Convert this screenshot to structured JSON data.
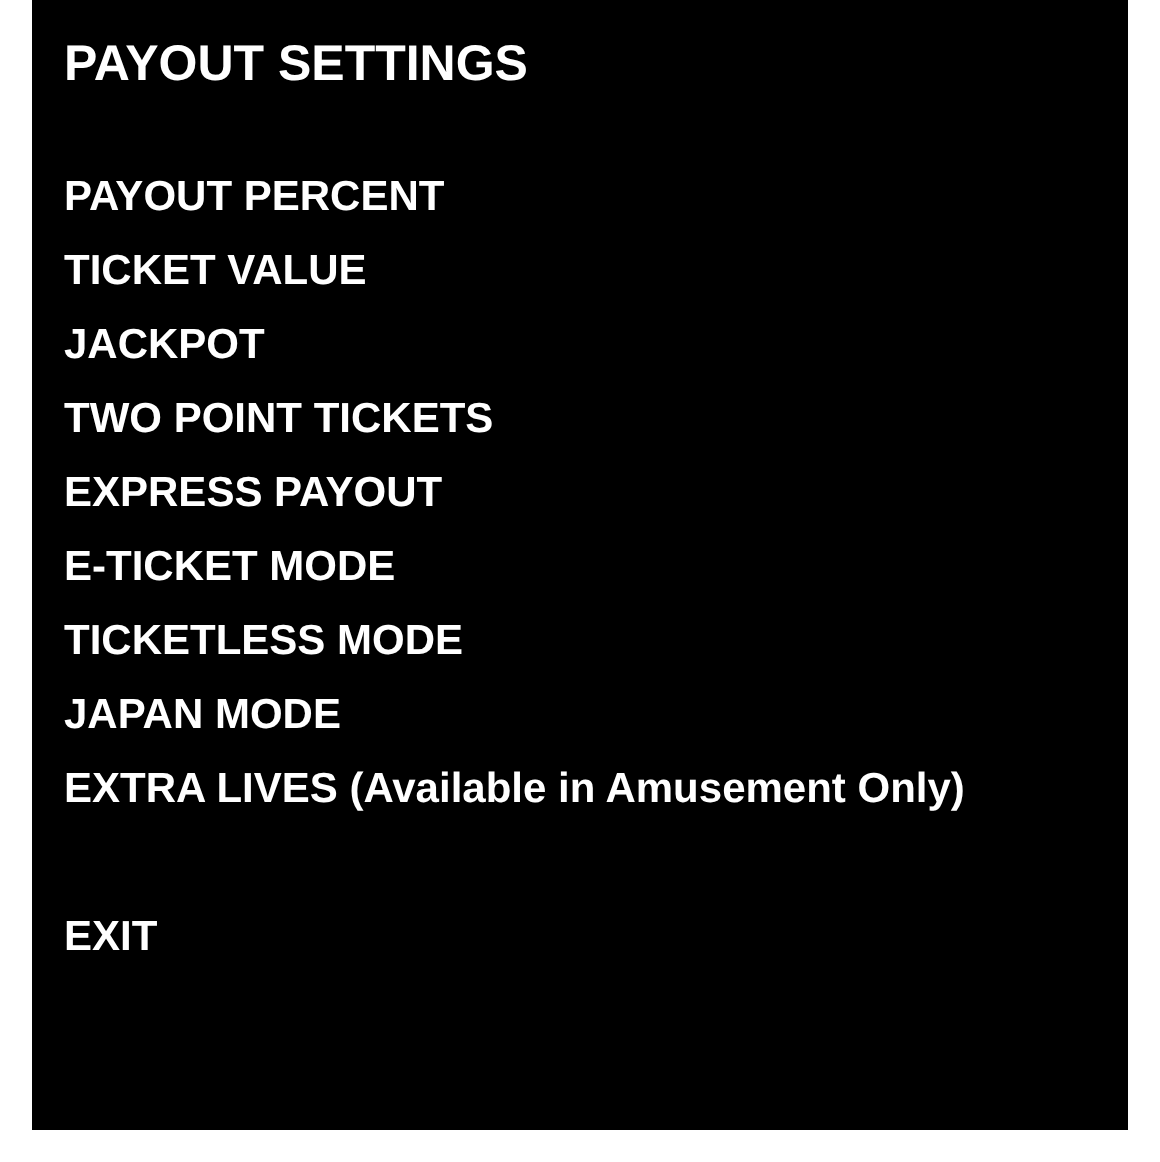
{
  "title": "PAYOUT SETTINGS",
  "menu_items": [
    {
      "label": "PAYOUT PERCENT"
    },
    {
      "label": "TICKET VALUE"
    },
    {
      "label": "JACKPOT"
    },
    {
      "label": "TWO POINT TICKETS"
    },
    {
      "label": "EXPRESS PAYOUT"
    },
    {
      "label": "E-TICKET MODE"
    },
    {
      "label": "TICKETLESS MODE"
    },
    {
      "label": "JAPAN MODE"
    },
    {
      "label": "EXTRA LIVES (Available in Amusement Only)"
    }
  ],
  "exit": {
    "label": "EXIT"
  }
}
